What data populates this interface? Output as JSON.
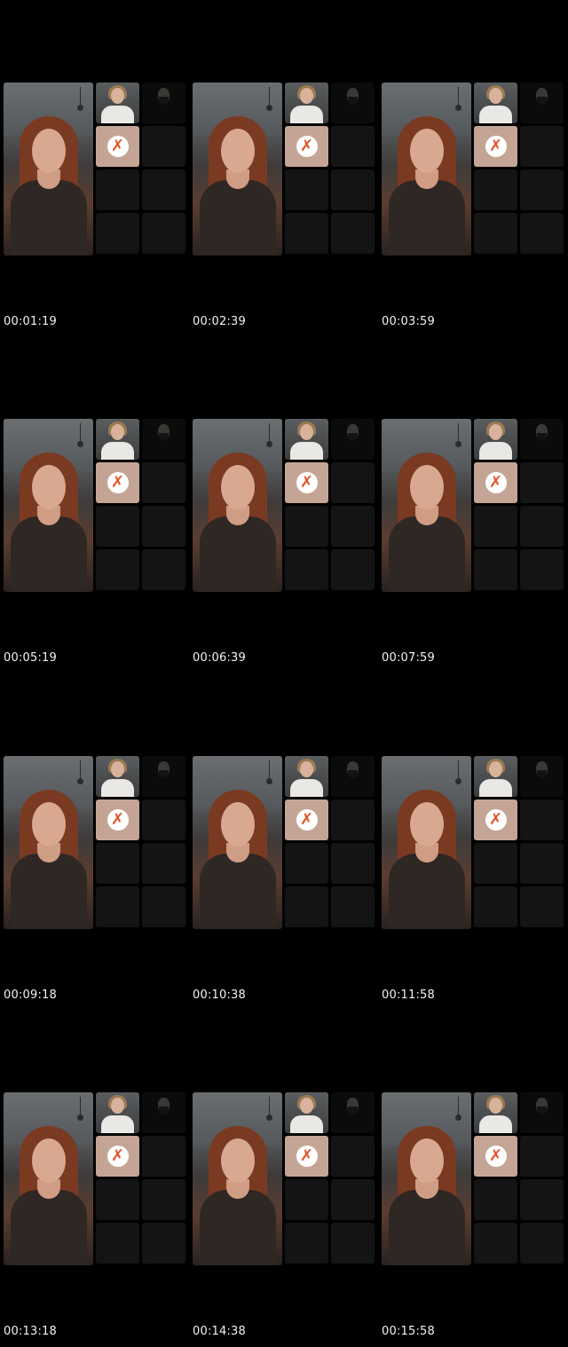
{
  "frames": [
    {
      "timestamp": "00:01:19"
    },
    {
      "timestamp": "00:02:39"
    },
    {
      "timestamp": "00:03:59"
    },
    {
      "timestamp": "00:05:19"
    },
    {
      "timestamp": "00:06:39"
    },
    {
      "timestamp": "00:07:59"
    },
    {
      "timestamp": "00:09:18"
    },
    {
      "timestamp": "00:10:38"
    },
    {
      "timestamp": "00:11:58"
    },
    {
      "timestamp": "00:13:18"
    },
    {
      "timestamp": "00:14:38"
    },
    {
      "timestamp": "00:15:58"
    }
  ],
  "icons": {
    "muted": "camera-off-x-icon",
    "mute_glyph": "✗"
  },
  "colors": {
    "background": "#000000",
    "mute_tile": "#c4a595",
    "mute_x": "#e2542a",
    "empty_cell": "#141414",
    "timestamp_text": "#f2f2f2"
  }
}
